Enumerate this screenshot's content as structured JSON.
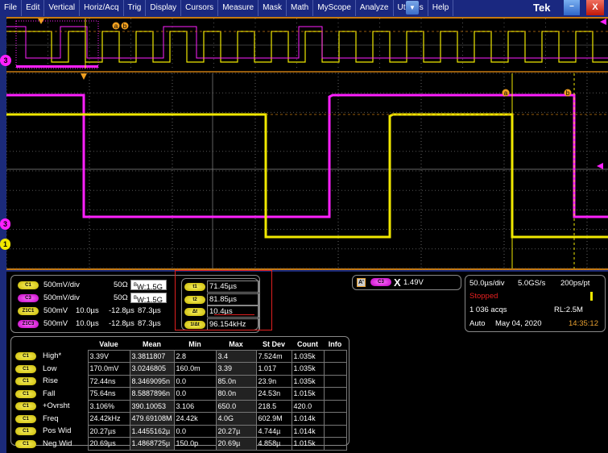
{
  "menu": [
    "File",
    "Edit",
    "Vertical",
    "Horiz/Acq",
    "Trig",
    "Display",
    "Cursors",
    "Measure",
    "Mask",
    "Math",
    "MyScope",
    "Analyze",
    "Utilities",
    "Help"
  ],
  "brand": "Tek",
  "minimize": "–",
  "close": "X",
  "dropdown": "▼",
  "markers": {
    "a": "a",
    "b": "b",
    "ch3": "3",
    "ch1": "1"
  },
  "colors": {
    "ch1": "#f0e800",
    "ch3": "#ff20ff",
    "frame": "#c87a10"
  },
  "channels": [
    {
      "badge": "C1",
      "scale": "500mV/div",
      "imp": "50Ω",
      "bw": "W:1.5G",
      "bwsup": "B"
    },
    {
      "badge": "C3",
      "scale": "500mV/div",
      "imp": "50Ω",
      "bw": "W:1.5G",
      "bwsup": "B"
    },
    {
      "badge": "Z1C1",
      "scale": "500mV",
      "t": "10.0µs",
      "a": "-12.8µs",
      "b": "87.3µs"
    },
    {
      "badge": "Z1C3",
      "scale": "500mV",
      "t": "10.0µs",
      "a": "-12.8µs",
      "b": "87.3µs"
    }
  ],
  "cursors": [
    {
      "label": "t1",
      "value": "71.45µs"
    },
    {
      "label": "t2",
      "value": "81.85µs"
    },
    {
      "label": "Δt",
      "value": "10.4µs"
    },
    {
      "label": "1/Δt",
      "value": "96.154kHz"
    }
  ],
  "trigger": {
    "mode": "A'",
    "source": "C3",
    "level": "1.49V"
  },
  "acq": {
    "timebase": "50.0µs/div",
    "rate": "5.0GS/s",
    "res": "200ps/pt",
    "state": "Stopped",
    "acqs": "1 036 acqs",
    "rl": "RL:2.5M",
    "trig_mode": "Auto",
    "date": "May 04, 2020",
    "time": "14:35:12"
  },
  "meas": {
    "headers": [
      "Value",
      "Mean",
      "Min",
      "Max",
      "St Dev",
      "Count",
      "Info"
    ],
    "rows": [
      {
        "src": "C1",
        "name": "High*",
        "cells": [
          "3.39V",
          "3.3811807",
          "2.8",
          "3.4",
          "7.524m",
          "1.035k",
          ""
        ]
      },
      {
        "src": "C1",
        "name": "Low",
        "cells": [
          "170.0mV",
          "3.0246805",
          "160.0m",
          "3.39",
          "1.017",
          "1.035k",
          ""
        ]
      },
      {
        "src": "C1",
        "name": "Rise",
        "cells": [
          "72.44ns",
          "8.3469095n",
          "0.0",
          "85.0n",
          "23.9n",
          "1.035k",
          ""
        ]
      },
      {
        "src": "C1",
        "name": "Fall",
        "cells": [
          "75.64ns",
          "8.5887896n",
          "0.0",
          "80.0n",
          "24.53n",
          "1.015k",
          ""
        ]
      },
      {
        "src": "C1",
        "name": "+Ovrsht",
        "cells": [
          "3.106%",
          "390.10053",
          "3.106",
          "650.0",
          "218.5",
          "420.0",
          ""
        ]
      },
      {
        "src": "C1",
        "name": "Freq",
        "cells": [
          "24.42kHz",
          "479.69108M",
          "24.42k",
          "4.0G",
          "602.9M",
          "1.014k",
          ""
        ]
      },
      {
        "src": "C1",
        "name": "Pos Wid",
        "cells": [
          "20.27µs",
          "1.4455162µ",
          "0.0",
          "20.27µ",
          "4.744µ",
          "1.014k",
          ""
        ]
      },
      {
        "src": "C1",
        "name": "Neg Wid",
        "cells": [
          "20.69µs",
          "1.4868725µ",
          "150.0p",
          "20.69µ",
          "4.858µ",
          "1.015k",
          ""
        ]
      }
    ]
  }
}
